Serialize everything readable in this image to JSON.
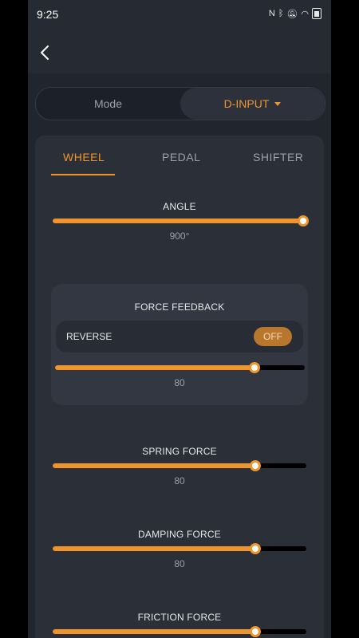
{
  "status": {
    "time": "9:25",
    "icons": [
      "nfc-icon",
      "bluetooth-icon",
      "mute-icon",
      "wifi-icon",
      "battery-icon"
    ]
  },
  "colors": {
    "accent": "#f0952e",
    "background": "#252a33",
    "card": "#2a2f38"
  },
  "header": {
    "back_icon": "chevron-left-icon"
  },
  "mode": {
    "left_label": "Mode",
    "right_label": "D-INPUT"
  },
  "tabs": [
    {
      "label": "WHEEL"
    },
    {
      "label": "PEDAL"
    },
    {
      "label": "SHIFTER"
    }
  ],
  "active_tab": "WHEEL",
  "angle": {
    "label": "ANGLE",
    "value": "900°",
    "level": 1.0
  },
  "force_feedback": {
    "label": "FORCE FEEDBACK",
    "reverse_label": "REVERSE",
    "reverse_state": "OFF",
    "value": "80",
    "level": 0.8
  },
  "spring": {
    "label": "SPRING FORCE",
    "value": "80",
    "level": 0.8
  },
  "damping": {
    "label": "DAMPING FORCE",
    "value": "80",
    "level": 0.8
  },
  "friction": {
    "label": "FRICTION FORCE",
    "level": 0.8
  }
}
